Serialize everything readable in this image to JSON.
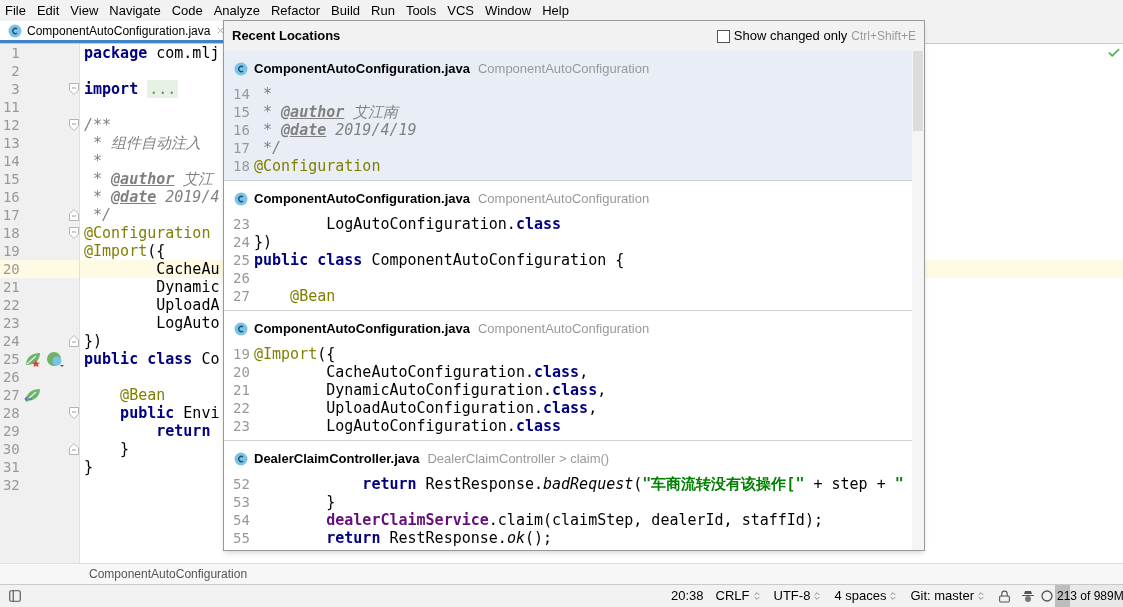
{
  "menu": [
    "File",
    "Edit",
    "View",
    "Navigate",
    "Code",
    "Analyze",
    "Refactor",
    "Build",
    "Run",
    "Tools",
    "VCS",
    "Window",
    "Help"
  ],
  "tabs": [
    {
      "label": "ComponentAutoConfiguration.java",
      "selected": true
    }
  ],
  "editor": {
    "lines": [
      {
        "number": "1",
        "current": false,
        "tokens": [
          {
            "text": "package",
            "kind": "keyword"
          },
          {
            "text": " com.mlj",
            "kind": "plain"
          }
        ]
      },
      {
        "number": "2",
        "current": false
      },
      {
        "number": "3",
        "current": false,
        "fold": {
          "kind": "open"
        },
        "tokens": [
          {
            "text": "import",
            "kind": "keyword"
          },
          {
            "text": "...",
            "kind": "folded"
          }
        ]
      },
      {
        "number": "11",
        "current": false
      },
      {
        "number": "12",
        "current": false,
        "fold": {
          "kind": "open"
        },
        "tokens": [
          {
            "text": "/**",
            "kind": "comment"
          }
        ]
      },
      {
        "number": "13",
        "current": false,
        "tokens": [
          {
            "text": " * 组件自动注入",
            "kind": "comment"
          }
        ]
      },
      {
        "number": "14",
        "current": false,
        "tokens": [
          {
            "text": " *",
            "kind": "comment"
          }
        ]
      },
      {
        "number": "15",
        "current": false,
        "tokens": [
          {
            "text": " * ",
            "kind": "comment"
          },
          {
            "text": "@author",
            "kind": "doctag"
          },
          {
            "text": " 艾江",
            "kind": "comment"
          }
        ]
      },
      {
        "number": "16",
        "current": false,
        "tokens": [
          {
            "text": " * ",
            "kind": "comment"
          },
          {
            "text": "@date",
            "kind": "doctag"
          },
          {
            "text": " 2019/4",
            "kind": "comment"
          }
        ]
      },
      {
        "number": "17",
        "current": false,
        "fold": {
          "kind": "close"
        },
        "tokens": [
          {
            "text": " */",
            "kind": "comment"
          }
        ]
      },
      {
        "number": "18",
        "current": false,
        "fold": {
          "kind": "open"
        },
        "tokens": [
          {
            "text": "@Configuration",
            "kind": "annotation"
          }
        ]
      },
      {
        "number": "19",
        "current": false,
        "tokens": [
          {
            "text": "@Import",
            "kind": "annotation"
          },
          {
            "text": "({",
            "kind": "plain"
          }
        ]
      },
      {
        "number": "20",
        "current": true,
        "tokens": [
          {
            "text": "        CacheAu",
            "kind": "plain"
          }
        ]
      },
      {
        "number": "21",
        "current": false,
        "tokens": [
          {
            "text": "        Dynamic",
            "kind": "plain"
          }
        ]
      },
      {
        "number": "22",
        "current": false,
        "tokens": [
          {
            "text": "        UploadA",
            "kind": "plain"
          }
        ]
      },
      {
        "number": "23",
        "current": false,
        "tokens": [
          {
            "text": "        LogAuto",
            "kind": "plain"
          }
        ]
      },
      {
        "number": "24",
        "current": false,
        "fold": {
          "kind": "close"
        },
        "tokens": [
          {
            "text": "})",
            "kind": "plain"
          }
        ]
      },
      {
        "number": "25",
        "current": false,
        "markers": [
          {
            "kind": "bean_star"
          },
          {
            "kind": "bean_class"
          }
        ],
        "tokens": [
          {
            "text": "public class",
            "kind": "keyword"
          },
          {
            "text": " Co",
            "kind": "plain"
          }
        ]
      },
      {
        "number": "26",
        "current": false
      },
      {
        "number": "27",
        "current": false,
        "markers": [
          {
            "kind": "bean_arrow"
          }
        ],
        "tokens": [
          {
            "text": "    @Bean",
            "kind": "annotation"
          }
        ]
      },
      {
        "number": "28",
        "current": false,
        "fold": {
          "kind": "open"
        },
        "tokens": [
          {
            "text": "    public",
            "kind": "keyword"
          },
          {
            "text": " Envi",
            "kind": "plain"
          }
        ]
      },
      {
        "number": "29",
        "current": false,
        "tokens": [
          {
            "text": "        return",
            "kind": "keyword"
          }
        ]
      },
      {
        "number": "30",
        "current": false,
        "fold": {
          "kind": "close"
        },
        "tokens": [
          {
            "text": "    }",
            "kind": "plain"
          }
        ]
      },
      {
        "number": "31",
        "current": false,
        "tokens": [
          {
            "text": "}",
            "kind": "plain"
          }
        ]
      },
      {
        "number": "32",
        "current": false
      }
    ]
  },
  "popup": {
    "title": "Recent Locations",
    "filter": {
      "label": "Show changed only",
      "checked": false,
      "shortcut": "Ctrl+Shift+E"
    },
    "entries": [
      {
        "file": "ComponentAutoConfiguration.java",
        "context": "ComponentAutoConfiguration",
        "selected": true,
        "lines": [
          {
            "number": "14",
            "tokens": [
              {
                "text": " *",
                "kind": "comment"
              }
            ]
          },
          {
            "number": "15",
            "tokens": [
              {
                "text": " * ",
                "kind": "comment"
              },
              {
                "text": "@author",
                "kind": "doctag"
              },
              {
                "text": " 艾江南",
                "kind": "comment"
              }
            ]
          },
          {
            "number": "16",
            "tokens": [
              {
                "text": " * ",
                "kind": "comment"
              },
              {
                "text": "@date",
                "kind": "doctag"
              },
              {
                "text": " 2019/4/19",
                "kind": "comment"
              }
            ]
          },
          {
            "number": "17",
            "tokens": [
              {
                "text": " */",
                "kind": "comment"
              }
            ]
          },
          {
            "number": "18",
            "tokens": [
              {
                "text": "@Configuration",
                "kind": "annotation"
              }
            ]
          }
        ]
      },
      {
        "file": "ComponentAutoConfiguration.java",
        "context": "ComponentAutoConfiguration",
        "selected": false,
        "lines": [
          {
            "number": "23",
            "tokens": [
              {
                "text": "        LogAutoConfiguration.",
                "kind": "plain"
              },
              {
                "text": "class",
                "kind": "keyword"
              }
            ]
          },
          {
            "number": "24",
            "tokens": [
              {
                "text": "})",
                "kind": "plain"
              }
            ]
          },
          {
            "number": "25",
            "tokens": [
              {
                "text": "public class",
                "kind": "keyword"
              },
              {
                "text": " ComponentAutoConfiguration {",
                "kind": "plain"
              }
            ]
          },
          {
            "number": "26"
          },
          {
            "number": "27",
            "tokens": [
              {
                "text": "    @Bean",
                "kind": "annotation"
              }
            ]
          }
        ]
      },
      {
        "file": "ComponentAutoConfiguration.java",
        "context": "ComponentAutoConfiguration",
        "selected": false,
        "lines": [
          {
            "number": "19",
            "tokens": [
              {
                "text": "@Import",
                "kind": "annotation"
              },
              {
                "text": "({",
                "kind": "plain"
              }
            ]
          },
          {
            "number": "20",
            "tokens": [
              {
                "text": "        CacheAutoConfiguration.",
                "kind": "plain"
              },
              {
                "text": "class",
                "kind": "keyword"
              },
              {
                "text": ",",
                "kind": "plain"
              }
            ]
          },
          {
            "number": "21",
            "tokens": [
              {
                "text": "        DynamicAutoConfiguration.",
                "kind": "plain"
              },
              {
                "text": "class",
                "kind": "keyword"
              },
              {
                "text": ",",
                "kind": "plain"
              }
            ]
          },
          {
            "number": "22",
            "tokens": [
              {
                "text": "        UploadAutoConfiguration.",
                "kind": "plain"
              },
              {
                "text": "class",
                "kind": "keyword"
              },
              {
                "text": ",",
                "kind": "plain"
              }
            ]
          },
          {
            "number": "23",
            "tokens": [
              {
                "text": "        LogAutoConfiguration.",
                "kind": "plain"
              },
              {
                "text": "class",
                "kind": "keyword"
              }
            ]
          }
        ]
      },
      {
        "file": "DealerClaimController.java",
        "context": "DealerClaimController > claim()",
        "selected": false,
        "lines": [
          {
            "number": "52",
            "tokens": [
              {
                "text": "            return",
                "kind": "keyword"
              },
              {
                "text": " RestResponse.",
                "kind": "plain"
              },
              {
                "text": "badRequest",
                "kind": "italic"
              },
              {
                "text": "(",
                "kind": "plain"
              },
              {
                "text": "\"车商流转没有该操作[\"",
                "kind": "string"
              },
              {
                "text": " + step + ",
                "kind": "plain"
              },
              {
                "text": "\"",
                "kind": "string"
              }
            ]
          },
          {
            "number": "53",
            "tokens": [
              {
                "text": "        }",
                "kind": "plain"
              }
            ]
          },
          {
            "number": "54",
            "tokens": [
              {
                "text": "        dealerClaimService",
                "kind": "field"
              },
              {
                "text": ".claim(claimStep, dealerId, staffId);",
                "kind": "plain"
              }
            ]
          },
          {
            "number": "55",
            "tokens": [
              {
                "text": "        return",
                "kind": "keyword"
              },
              {
                "text": " RestResponse.",
                "kind": "plain"
              },
              {
                "text": "ok",
                "kind": "italic"
              },
              {
                "text": "();",
                "kind": "plain"
              }
            ]
          }
        ]
      }
    ]
  },
  "breadcrumb": "ComponentAutoConfiguration",
  "status_bar": {
    "items": [
      "20:38",
      "CRLF",
      "UTF-8",
      "4 spaces",
      "Git: master"
    ],
    "memory": {
      "text": "213 of 989M",
      "level": 0.22
    }
  }
}
